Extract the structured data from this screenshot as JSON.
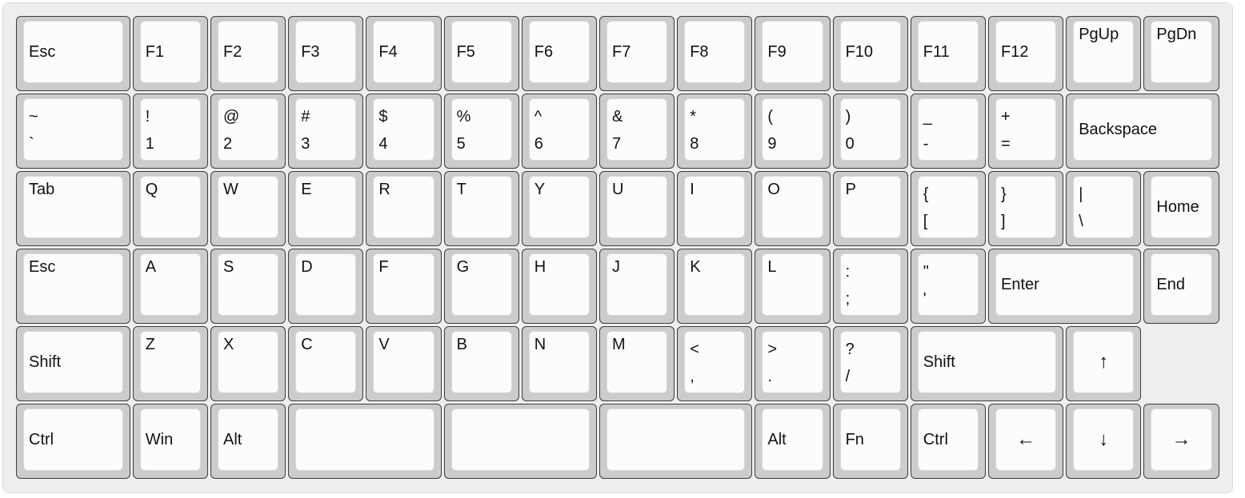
{
  "keyboard": {
    "rows": [
      [
        {
          "label": "Esc",
          "style": "mid",
          "u": 1.5,
          "name": "key-esc"
        },
        {
          "label": "F1",
          "style": "mid",
          "u": 1,
          "name": "key-f1"
        },
        {
          "label": "F2",
          "style": "mid",
          "u": 1,
          "name": "key-f2"
        },
        {
          "label": "F3",
          "style": "mid",
          "u": 1,
          "name": "key-f3"
        },
        {
          "label": "F4",
          "style": "mid",
          "u": 1,
          "name": "key-f4"
        },
        {
          "label": "F5",
          "style": "mid",
          "u": 1,
          "name": "key-f5"
        },
        {
          "label": "F6",
          "style": "mid",
          "u": 1,
          "name": "key-f6"
        },
        {
          "label": "F7",
          "style": "mid",
          "u": 1,
          "name": "key-f7"
        },
        {
          "label": "F8",
          "style": "mid",
          "u": 1,
          "name": "key-f8"
        },
        {
          "label": "F9",
          "style": "mid",
          "u": 1,
          "name": "key-f9"
        },
        {
          "label": "F10",
          "style": "mid",
          "u": 1,
          "name": "key-f10"
        },
        {
          "label": "F11",
          "style": "mid",
          "u": 1,
          "name": "key-f11"
        },
        {
          "label": "F12",
          "style": "mid",
          "u": 1,
          "name": "key-f12"
        },
        {
          "label": "PgUp",
          "style": "top",
          "u": 1,
          "name": "key-pgup"
        },
        {
          "label": "PgDn",
          "style": "top",
          "u": 1,
          "name": "key-pgdn"
        }
      ],
      [
        {
          "upper": "~",
          "lower": "`",
          "u": 1.5,
          "name": "key-backtick"
        },
        {
          "upper": "!",
          "lower": "1",
          "u": 1,
          "name": "key-1"
        },
        {
          "upper": "@",
          "lower": "2",
          "u": 1,
          "name": "key-2"
        },
        {
          "upper": "#",
          "lower": "3",
          "u": 1,
          "name": "key-3"
        },
        {
          "upper": "$",
          "lower": "4",
          "u": 1,
          "name": "key-4"
        },
        {
          "upper": "%",
          "lower": "5",
          "u": 1,
          "name": "key-5"
        },
        {
          "upper": "^",
          "lower": "6",
          "u": 1,
          "name": "key-6"
        },
        {
          "upper": "&",
          "lower": "7",
          "u": 1,
          "name": "key-7"
        },
        {
          "upper": "*",
          "lower": "8",
          "u": 1,
          "name": "key-8"
        },
        {
          "upper": "(",
          "lower": "9",
          "u": 1,
          "name": "key-9"
        },
        {
          "upper": ")",
          "lower": "0",
          "u": 1,
          "name": "key-0"
        },
        {
          "upper": "_",
          "lower": "-",
          "u": 1,
          "name": "key-minus"
        },
        {
          "upper": "+",
          "lower": "=",
          "u": 1,
          "name": "key-equals"
        },
        {
          "label": "Backspace",
          "style": "mid",
          "u": 2,
          "name": "key-backspace"
        }
      ],
      [
        {
          "label": "Tab",
          "style": "top",
          "u": 1.5,
          "name": "key-tab"
        },
        {
          "label": "Q",
          "style": "top",
          "u": 1,
          "name": "key-q"
        },
        {
          "label": "W",
          "style": "top",
          "u": 1,
          "name": "key-w"
        },
        {
          "label": "E",
          "style": "top",
          "u": 1,
          "name": "key-e"
        },
        {
          "label": "R",
          "style": "top",
          "u": 1,
          "name": "key-r"
        },
        {
          "label": "T",
          "style": "top",
          "u": 1,
          "name": "key-t"
        },
        {
          "label": "Y",
          "style": "top",
          "u": 1,
          "name": "key-y"
        },
        {
          "label": "U",
          "style": "top",
          "u": 1,
          "name": "key-u"
        },
        {
          "label": "I",
          "style": "top",
          "u": 1,
          "name": "key-i"
        },
        {
          "label": "O",
          "style": "top",
          "u": 1,
          "name": "key-o"
        },
        {
          "label": "P",
          "style": "top",
          "u": 1,
          "name": "key-p"
        },
        {
          "upper": "{",
          "lower": "[",
          "u": 1,
          "name": "key-left-bracket"
        },
        {
          "upper": "}",
          "lower": "]",
          "u": 1,
          "name": "key-right-bracket"
        },
        {
          "upper": "|",
          "lower": "\\",
          "u": 1,
          "name": "key-backslash"
        },
        {
          "label": "Home",
          "style": "mid",
          "u": 1,
          "name": "key-home"
        }
      ],
      [
        {
          "label": "Esc",
          "style": "top",
          "u": 1.5,
          "name": "key-esc-caps"
        },
        {
          "label": "A",
          "style": "top",
          "u": 1,
          "name": "key-a"
        },
        {
          "label": "S",
          "style": "top",
          "u": 1,
          "name": "key-s"
        },
        {
          "label": "D",
          "style": "top",
          "u": 1,
          "name": "key-d"
        },
        {
          "label": "F",
          "style": "top",
          "u": 1,
          "name": "key-f"
        },
        {
          "label": "G",
          "style": "top",
          "u": 1,
          "name": "key-g"
        },
        {
          "label": "H",
          "style": "top",
          "u": 1,
          "name": "key-h"
        },
        {
          "label": "J",
          "style": "top",
          "u": 1,
          "name": "key-j"
        },
        {
          "label": "K",
          "style": "top",
          "u": 1,
          "name": "key-k"
        },
        {
          "label": "L",
          "style": "top",
          "u": 1,
          "name": "key-l"
        },
        {
          "upper": ":",
          "lower": ";",
          "u": 1,
          "name": "key-semicolon"
        },
        {
          "upper": "\"",
          "lower": "'",
          "u": 1,
          "name": "key-quote"
        },
        {
          "label": "Enter",
          "style": "mid",
          "u": 2,
          "name": "key-enter"
        },
        {
          "label": "End",
          "style": "mid",
          "u": 1,
          "name": "key-end"
        }
      ],
      [
        {
          "label": "Shift",
          "style": "mid",
          "u": 1.5,
          "name": "key-left-shift"
        },
        {
          "label": "Z",
          "style": "top",
          "u": 1,
          "name": "key-z"
        },
        {
          "label": "X",
          "style": "top",
          "u": 1,
          "name": "key-x"
        },
        {
          "label": "C",
          "style": "top",
          "u": 1,
          "name": "key-c"
        },
        {
          "label": "V",
          "style": "top",
          "u": 1,
          "name": "key-v"
        },
        {
          "label": "B",
          "style": "top",
          "u": 1,
          "name": "key-b"
        },
        {
          "label": "N",
          "style": "top",
          "u": 1,
          "name": "key-n"
        },
        {
          "label": "M",
          "style": "top",
          "u": 1,
          "name": "key-m"
        },
        {
          "upper": "<",
          "lower": ",",
          "u": 1,
          "name": "key-comma"
        },
        {
          "upper": ">",
          "lower": ".",
          "u": 1,
          "name": "key-period"
        },
        {
          "upper": "?",
          "lower": "/",
          "u": 1,
          "name": "key-slash"
        },
        {
          "label": "Shift",
          "style": "mid",
          "u": 2,
          "name": "key-right-shift"
        },
        {
          "label": "↑",
          "style": "center",
          "u": 1,
          "name": "key-arrow-up",
          "icon": "arrow-up-icon"
        }
      ],
      [
        {
          "label": "Ctrl",
          "style": "mid",
          "u": 1.5,
          "name": "key-left-ctrl"
        },
        {
          "label": "Win",
          "style": "mid",
          "u": 1,
          "name": "key-win"
        },
        {
          "label": "Alt",
          "style": "mid",
          "u": 1,
          "name": "key-left-alt"
        },
        {
          "label": "",
          "style": "mid",
          "u": 2,
          "name": "key-space-left"
        },
        {
          "label": "",
          "style": "mid",
          "u": 2,
          "name": "key-space-middle"
        },
        {
          "label": "",
          "style": "mid",
          "u": 2,
          "name": "key-space-right"
        },
        {
          "label": "Alt",
          "style": "mid",
          "u": 1,
          "name": "key-right-alt"
        },
        {
          "label": "Fn",
          "style": "mid",
          "u": 1,
          "name": "key-fn"
        },
        {
          "label": "Ctrl",
          "style": "mid",
          "u": 1,
          "name": "key-right-ctrl"
        },
        {
          "label": "←",
          "style": "center",
          "u": 1,
          "name": "key-arrow-left",
          "icon": "arrow-left-icon"
        },
        {
          "label": "↓",
          "style": "center",
          "u": 1,
          "name": "key-arrow-down",
          "icon": "arrow-down-icon"
        },
        {
          "label": "→",
          "style": "center",
          "u": 1,
          "name": "key-arrow-right",
          "icon": "arrow-right-icon"
        }
      ]
    ]
  }
}
